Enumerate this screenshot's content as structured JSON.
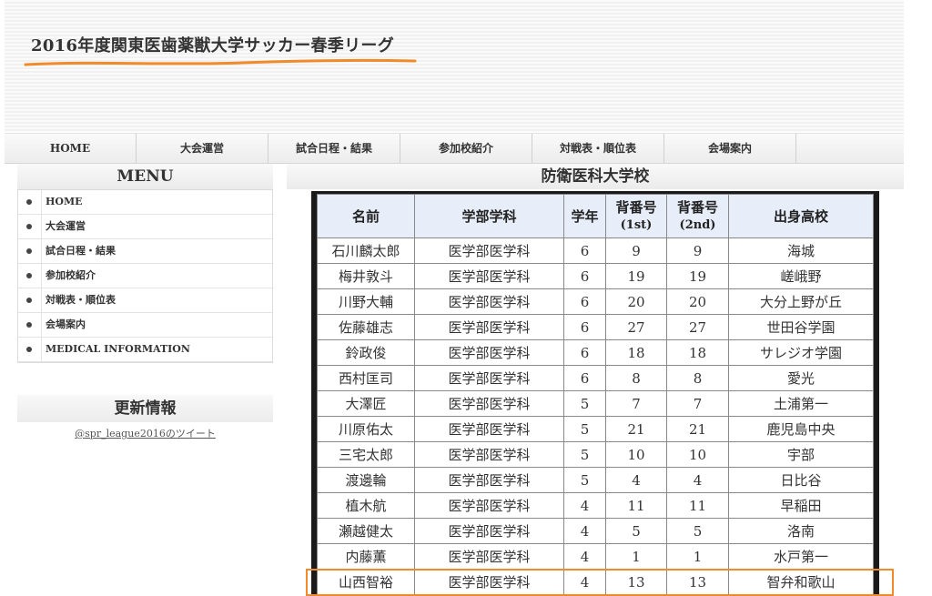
{
  "site": {
    "title": "2016年度関東医歯薬獣大学サッカー春季リーグ",
    "accent_color": "#f08a2a"
  },
  "nav": {
    "items": [
      "HOME",
      "大会運営",
      "試合日程・結果",
      "参加校紹介",
      "対戦表・順位表",
      "会場案内"
    ]
  },
  "sidebar": {
    "menu_heading": "MENU",
    "menu_items": [
      "HOME",
      "大会運営",
      "試合日程・結果",
      "参加校紹介",
      "対戦表・順位表",
      "会場案内",
      "MEDICAL INFORMATION"
    ],
    "update_heading": "更新情報",
    "tweet_link": "@spr_league2016のツイート"
  },
  "main": {
    "school_name": "防衛医科大学校",
    "table": {
      "headers": {
        "name": "名前",
        "dept": "学部学科",
        "grade": "学年",
        "num1_main": "背番号",
        "num1_sub": "(1st)",
        "num2_main": "背番号",
        "num2_sub": "(2nd)",
        "school": "出身高校"
      },
      "rows": [
        [
          "石川麟太郎",
          "医学部医学科",
          "6",
          "9",
          "9",
          "海城"
        ],
        [
          "梅井敦斗",
          "医学部医学科",
          "6",
          "19",
          "19",
          "嵯峨野"
        ],
        [
          "川野大輔",
          "医学部医学科",
          "6",
          "20",
          "20",
          "大分上野が丘"
        ],
        [
          "佐藤雄志",
          "医学部医学科",
          "6",
          "27",
          "27",
          "世田谷学園"
        ],
        [
          "鈴政俊",
          "医学部医学科",
          "6",
          "18",
          "18",
          "サレジオ学園"
        ],
        [
          "西村匡司",
          "医学部医学科",
          "6",
          "8",
          "8",
          "愛光"
        ],
        [
          "大澤匠",
          "医学部医学科",
          "5",
          "7",
          "7",
          "土浦第一"
        ],
        [
          "川原佑太",
          "医学部医学科",
          "5",
          "21",
          "21",
          "鹿児島中央"
        ],
        [
          "三宅太郎",
          "医学部医学科",
          "5",
          "10",
          "10",
          "宇部"
        ],
        [
          "渡邊輪",
          "医学部医学科",
          "5",
          "4",
          "4",
          "日比谷"
        ],
        [
          "植木航",
          "医学部医学科",
          "4",
          "11",
          "11",
          "早稲田"
        ],
        [
          "瀬越健太",
          "医学部医学科",
          "4",
          "5",
          "5",
          "洛南"
        ],
        [
          "内藤薫",
          "医学部医学科",
          "4",
          "1",
          "1",
          "水戸第一"
        ],
        [
          "山西智裕",
          "医学部医学科",
          "4",
          "13",
          "13",
          "智弁和歌山"
        ]
      ]
    }
  }
}
